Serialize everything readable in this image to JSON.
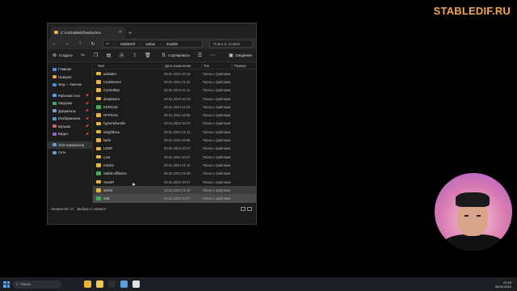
{
  "brand": "STABLEDIF.RU",
  "window": {
    "tab_title": "C:\\AI\\StableDif\\webui\\mo",
    "new_tab": "+",
    "nav": {
      "back": "←",
      "forward": "→",
      "up": "↑",
      "refresh": "↻",
      "monitor": "▭"
    },
    "breadcrumb": [
      "StableDif",
      "webui",
      "models"
    ],
    "breadcrumb_sep": "›",
    "search_placeholder": "Поиск в: models",
    "toolbar": {
      "new_label": "Создать",
      "sort_label": "Сортировать",
      "details_label": "Сведения"
    },
    "sidebar": {
      "items": [
        {
          "label": "Главная",
          "color": "#4d8fe8"
        },
        {
          "label": "Галерея",
          "color": "#e8a33c"
        },
        {
          "label": "oleg — Личное",
          "color": "#3c8ee8"
        }
      ],
      "quick": [
        {
          "label": "Рабочий стол",
          "color": "#4aa3ff"
        },
        {
          "label": "Загрузки",
          "color": "#33b46a"
        },
        {
          "label": "Документы",
          "color": "#7b9bd8"
        },
        {
          "label": "Изображения",
          "color": "#3c9fe0"
        },
        {
          "label": "Музыка",
          "color": "#d65e5e"
        },
        {
          "label": "Видео",
          "color": "#9b5cd6"
        }
      ],
      "devices": [
        {
          "label": "Этот компьютер",
          "color": "#5aa0e0"
        },
        {
          "label": "Сеть",
          "color": "#5aa0e0"
        }
      ]
    },
    "columns": {
      "name": "Имя",
      "date": "Дата изменения",
      "type": "Тип",
      "size": "Размер"
    },
    "rows": [
      {
        "name": "adetailer",
        "date": "30.01.2024 20:16",
        "type": "Папка с файлами",
        "green": false,
        "state": ""
      },
      {
        "name": "Codeformer",
        "date": "30.01.2024 21:21",
        "type": "Папка с файлами",
        "green": false,
        "state": ""
      },
      {
        "name": "ControlNet",
        "date": "30.01.2024 21:11",
        "type": "Папка с файлами",
        "green": false,
        "state": ""
      },
      {
        "name": "deepbooru",
        "date": "24.01.2023 22:24",
        "type": "Папка с файлами",
        "green": false,
        "state": ""
      },
      {
        "name": "ESRGAN",
        "date": "30.01.2024 21:01",
        "type": "Папка с файлами",
        "green": true,
        "state": ""
      },
      {
        "name": "GFPGAN",
        "date": "30.01.2024 20:55",
        "type": "Папка с файлами",
        "green": false,
        "state": ""
      },
      {
        "name": "hypernetworks",
        "date": "30.01.2024 20:47",
        "type": "Папка с файлами",
        "green": false,
        "state": ""
      },
      {
        "name": "insightface",
        "date": "30.01.2024 21:11",
        "type": "Папка с файлами",
        "green": false,
        "state": ""
      },
      {
        "name": "karlo",
        "date": "30.01.2024 20:55",
        "type": "Папка с файлами",
        "green": false,
        "state": ""
      },
      {
        "name": "LDSR",
        "date": "30.01.2024 20:47",
        "type": "Папка с файлами",
        "green": false,
        "state": ""
      },
      {
        "name": "Lora",
        "date": "30.01.2024 20:47",
        "type": "Папка с файлами",
        "green": false,
        "state": ""
      },
      {
        "name": "reactor",
        "date": "30.01.2024 21:10",
        "type": "Папка с файлами",
        "green": false,
        "state": ""
      },
      {
        "name": "Stable-diffusion",
        "date": "06.02.2024 21:59",
        "type": "Папка с файлами",
        "green": true,
        "state": ""
      },
      {
        "name": "SwinIR",
        "date": "30.01.2024 20:47",
        "type": "Папка с файлами",
        "green": false,
        "state": ""
      },
      {
        "name": "uDreit",
        "date": "30.01.2024 21:40",
        "type": "Папка с файлами",
        "green": false,
        "state": "hover"
      },
      {
        "name": "VAE",
        "date": "30.01.2024 21:07",
        "type": "Папка с файлами",
        "green": true,
        "state": "selected"
      },
      {
        "name": "VAE-approx",
        "date": "06.02.2024 21:36",
        "type": "Папка с файлами",
        "green": false,
        "state": ""
      }
    ],
    "status": {
      "count": "Элементов: 17",
      "selected": "Выбран 1 элемент"
    }
  },
  "taskbar": {
    "search_label": "Поиск",
    "icons": [
      {
        "name": "files-icon",
        "color": "#e8b43c"
      },
      {
        "name": "task-icon",
        "color": "#f2c94c"
      },
      {
        "name": "terminal-icon",
        "color": "#2d2d2d"
      },
      {
        "name": "app-icon",
        "color": "#5aa0e0"
      },
      {
        "name": "browser-icon",
        "color": "#e0e0e0"
      }
    ],
    "time": "22:28",
    "date": "06.02.2024"
  }
}
